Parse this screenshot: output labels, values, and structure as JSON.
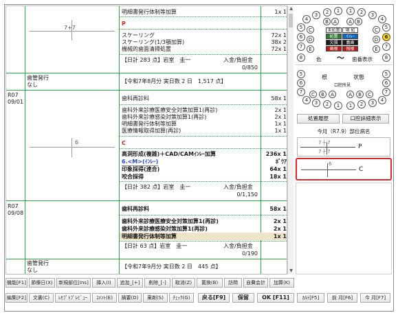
{
  "record": {
    "top": {
      "line_ijyo": "明細書発行体制等加算",
      "line_ijyo_count": "1x 1",
      "tooth_mark": "7+7",
      "section_p": "P",
      "items": [
        {
          "name": "スケーリング",
          "count": "72x 1"
        },
        {
          "name": "スケーリング(1/3顎加算)",
          "count": "38x 2"
        },
        {
          "name": "機械的歯面清掃処置",
          "count": "72x 1"
        }
      ],
      "summary": "【日計 283 点】岩室　圭一",
      "payment_label": "入金/負担金",
      "payment_value": "0/850"
    },
    "bill1": {
      "label": "歯管発行",
      "sub": "なし",
      "text": "【令和7年8月分 実日数 2 日　1,517 点】"
    },
    "visit1": {
      "date_l1": "R07",
      "date_l2": "09/01",
      "items": [
        {
          "name": "歯科再診料",
          "count": "58x 1"
        },
        {
          "name": "歯科外来診療医療安全対策加算1(再診)",
          "count": "2x 1"
        },
        {
          "name": "歯科外来診療感染対策加算1(再診)",
          "count": "2x 1"
        },
        {
          "name": "明細書発行体制等加算",
          "count": "1x 1"
        },
        {
          "name": "医療情報取得加算(再診)",
          "count": "1x 1"
        }
      ],
      "tooth_mark": "6",
      "section_c": "C",
      "proc_items": [
        {
          "name": "高洞形成(複雑)＋CAD/CAMｲﾝﾚｰ加算",
          "count": "236x 1"
        },
        {
          "name": "6.<M>(ｲﾝﾚｰ)",
          "count": "ﾎﾞｳｱ"
        },
        {
          "name": "印象採得(連合)",
          "count": "64x 1"
        },
        {
          "name": "咬合採得",
          "count": "18x 1"
        }
      ],
      "summary": "【日計 382 点】岩室　圭一",
      "payment_label": "入金/負担金",
      "payment_value": "0/1,150"
    },
    "visit2": {
      "date_l1": "R07",
      "date_l2": "09/08",
      "items": [
        {
          "name": "歯科再診料",
          "count": "58x 1"
        },
        {
          "name": "歯科外来診療医療安全対策加算1(再診)",
          "count": "2x 1"
        },
        {
          "name": "歯科外来診療感染対策加算1(再診)",
          "count": "2x 1"
        },
        {
          "name": "明細書発行体制等加算",
          "count": "1x 1"
        }
      ],
      "summary": "【日計 63 点】岩室　圭一",
      "payment_label": "入金/負担金",
      "payment_value": "0/190"
    },
    "bill2": {
      "label": "歯管発行",
      "sub": "なし",
      "text": "【令和7年9月分 実日数 2 日　445 点】"
    }
  },
  "fkeys_row1": [
    "機能[F1]",
    "節療日(X)",
    "新規部位[Ins]",
    "挿入(I)",
    "追加_[+]",
    "削除_[-]",
    "取消(Z)",
    "置換(B)",
    "訪問",
    "自費会計",
    "加算(K)"
  ],
  "fkeys_row2": [
    "編集[F2]",
    "文書(C)",
    "ﾚｾﾌﾟﾄﾌﾟﾚﾋﾞｭｰ",
    "ｺﾒﾝﾄ(E)",
    "摘要(D)",
    "薬剤(S)",
    "ﾁｪｯｸ(G)",
    "戻る[F9]",
    "保留",
    "OK [F11]"
  ],
  "side": {
    "upper_numbers": [
      "4",
      "3",
      "2",
      "1",
      "1",
      "2",
      "3",
      "4"
    ],
    "letters_row": [
      "B",
      "A",
      "A",
      "B"
    ],
    "left_col": [
      "5",
      "6",
      "7",
      "8"
    ],
    "left_letters": [
      "C",
      "D",
      "E"
    ],
    "right_col": [
      "5",
      "6",
      "7",
      "8"
    ],
    "right_letters": [
      "C",
      "D",
      "E"
    ],
    "legend": [
      {
        "label": "未処置",
        "color": "#ffffff"
      },
      {
        "label": "現 処",
        "color": "#ffffff"
      },
      {
        "label": "処置",
        "color": "#2e7d32"
      },
      {
        "label": "ｲﾝﾚｰ",
        "color": "#1565c0"
      },
      {
        "label": "欠損",
        "color": "#1a1a1a"
      },
      {
        "label": "義歯",
        "color": "#1a1a1a"
      },
      {
        "label": "歯根",
        "color": "#b71c1c"
      },
      {
        "label": "残根",
        "color": "#b71c1c"
      }
    ],
    "color_label": "色",
    "tilde": "〜",
    "tooth_display": "歯番表示",
    "root_label": "根",
    "state_label": "状態",
    "mouth_label": "口腔所見",
    "lower_numbers": [
      "4",
      "3",
      "2",
      "1",
      "1",
      "2",
      "3",
      "4"
    ],
    "lower_letters_row": [
      "C",
      "B",
      "A",
      "A",
      "B",
      "C"
    ],
    "btn_history": "処置履歴",
    "btn_detail": "口腔詳細表示",
    "today_header": "今月（R7.9）部位病名",
    "chart1_top": "7 ┼ 7",
    "chart1_bot": "7 ┼ 7",
    "chart1_label": "P",
    "chart2_num": "6",
    "chart2_label": "C",
    "accent_red": "#e0282a"
  },
  "bottom_right": [
    "ｶﾙﾃ[F5]",
    "前 月[F6]",
    "今 月[F7]"
  ]
}
